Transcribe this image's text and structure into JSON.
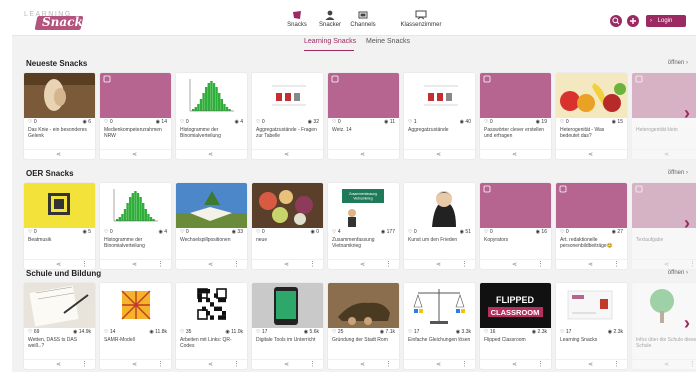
{
  "header": {
    "logo_top": "LEARNING",
    "logo_word": "Snacks",
    "nav": [
      {
        "label": "Snacks",
        "icon": "snack-icon"
      },
      {
        "label": "Snacker",
        "icon": "user-icon"
      },
      {
        "label": "Channels",
        "icon": "channel-icon"
      },
      {
        "label": "Klassenzimmer",
        "icon": "classroom-icon"
      }
    ],
    "search_icon": "search-icon",
    "add_icon": "plus-icon",
    "login_label": "Login"
  },
  "subtabs": [
    "Learning Snacks",
    "Meine Snacks"
  ],
  "sections": [
    {
      "title": "Neueste Snacks",
      "open_label": "öffnen",
      "cards": [
        {
          "title": "Das Knie - ein besonderes Gelenk",
          "likes": "0",
          "views": "6",
          "thumb": "knee"
        },
        {
          "title": "Medienkompetenzrahmen NRW",
          "likes": "0",
          "views": "14",
          "thumb": "plain"
        },
        {
          "title": "Histogramme der Binomialverteilung",
          "likes": "0",
          "views": "4",
          "thumb": "histogram"
        },
        {
          "title": "Aggregatzustände - Fragen zur Tabelle",
          "likes": "0",
          "views": "32",
          "thumb": "table"
        },
        {
          "title": "Wetz. 14",
          "likes": "0",
          "views": "11",
          "thumb": "plain"
        },
        {
          "title": "Aggregatzustände",
          "likes": "1",
          "views": "40",
          "thumb": "table"
        },
        {
          "title": "Passwörter clever erstellen und erfragen",
          "likes": "0",
          "views": "19",
          "thumb": "plain"
        },
        {
          "title": "Heterogenität - Was bedeutet das?",
          "likes": "0",
          "views": "15",
          "thumb": "fruit"
        },
        {
          "title": "Heterogenität klein",
          "likes": "",
          "views": "",
          "thumb": "plain"
        }
      ]
    },
    {
      "title": "OER Snacks",
      "open_label": "öffnen",
      "cards": [
        {
          "title": "Beatmusik",
          "likes": "0",
          "views": "5",
          "thumb": "yellow"
        },
        {
          "title": "Histogramme der Binomialverteilung",
          "likes": "0",
          "views": "4",
          "thumb": "histogram"
        },
        {
          "title": "Wechselspillpositionen",
          "likes": "0",
          "views": "33",
          "thumb": "book"
        },
        {
          "title": "neue",
          "likes": "0",
          "views": "0",
          "thumb": "food"
        },
        {
          "title": "Zusammenfassung Vietnamkrieg",
          "likes": "4",
          "views": "177",
          "thumb": "summary"
        },
        {
          "title": "Kunst um den Frieden",
          "likes": "0",
          "views": "51",
          "thumb": "portrait"
        },
        {
          "title": "Kopyrators",
          "likes": "0",
          "views": "16",
          "thumb": "plain"
        },
        {
          "title": "Art. redaktionelle personenbildbeiträge😊",
          "likes": "0",
          "views": "27",
          "thumb": "plain"
        },
        {
          "title": "Textaufgabe",
          "likes": "",
          "views": "",
          "thumb": "plain"
        }
      ]
    },
    {
      "title": "Schule und Bildung",
      "open_label": "öffnen",
      "cards": [
        {
          "title": "Wetten, DASS ts DAS weiß..?",
          "likes": "69",
          "views": "14.9k",
          "thumb": "notebook"
        },
        {
          "title": "SAMR-Modell",
          "likes": "14",
          "views": "11.8k",
          "thumb": "pattern"
        },
        {
          "title": "Arbeiten mit Links: QR-Codes",
          "likes": "35",
          "views": "11.0k",
          "thumb": "qr"
        },
        {
          "title": "Digitale Tools im Unterricht",
          "likes": "17",
          "views": "5.6k",
          "thumb": "phone"
        },
        {
          "title": "Gründung der Stadt Rom",
          "likes": "25",
          "views": "7.1k",
          "thumb": "wolf"
        },
        {
          "title": "Einfache Gleichungen lösen",
          "likes": "17",
          "views": "3.3k",
          "thumb": "scale"
        },
        {
          "title": "Flipped Classroom",
          "likes": "16",
          "views": "2.3k",
          "thumb": "flipped"
        },
        {
          "title": "Learning Snacks",
          "likes": "17",
          "views": "2.3k",
          "thumb": "ls"
        },
        {
          "title": "Infos über die Schule dieser Schule",
          "likes": "",
          "views": "",
          "thumb": "tree"
        }
      ]
    }
  ],
  "flipped_label": "FLIPPED CLASSROOM",
  "summary_label": "Zusammenfassung Vietnamkrieg",
  "colors": {
    "brand": "#9c2a62",
    "tile": "#b5658f",
    "accent": "#c4307a"
  }
}
